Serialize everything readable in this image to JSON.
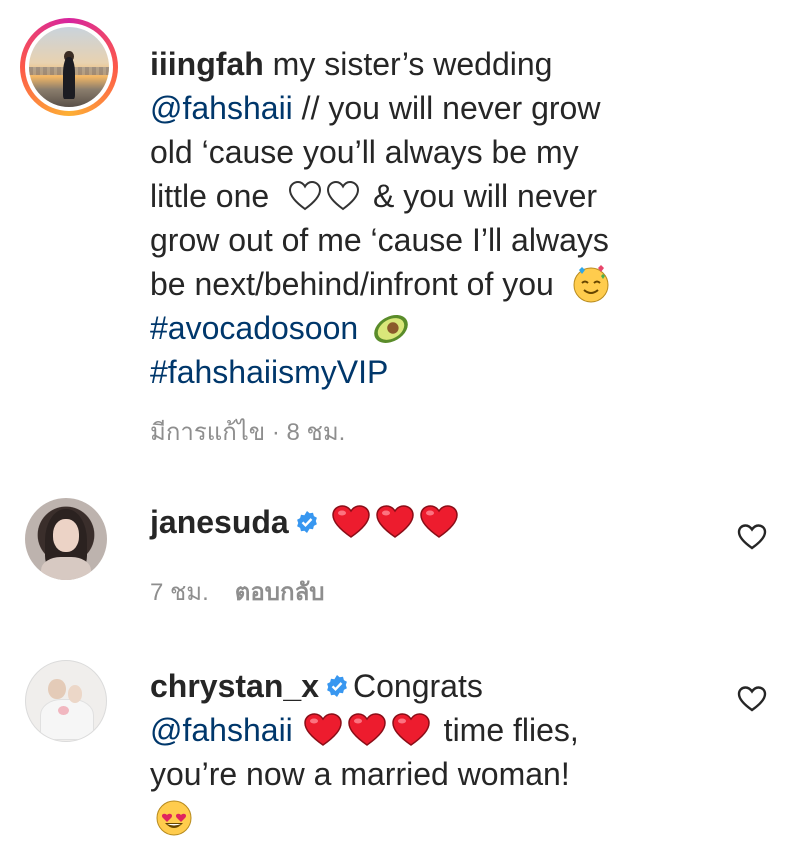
{
  "comments": [
    {
      "username": "iiingfah",
      "line1_text": " my sister’s wedding",
      "mention": "@fahshaii",
      "line2_text": " // you will never grow",
      "line3_text": "old ‘cause you’ll always be my",
      "line4_text": "little one",
      "line4_after": " & you will never",
      "line5_text": "grow out of me ‘cause I’ll always",
      "line6_text": "be next/behind/infront of you",
      "hashtag1": "#avocadosoon",
      "hashtag2": "#fahshaiismyVIP",
      "meta": "มีการแก้ไข · 8 ชม.",
      "emojis": [
        "white-heart",
        "white-heart",
        "smiling-face-with-hearts",
        "avocado"
      ]
    },
    {
      "username": "janesuda",
      "verified": true,
      "time": "7 ชม.",
      "reply_label": "ตอบกลับ",
      "emojis": [
        "red-heart",
        "red-heart",
        "red-heart"
      ]
    },
    {
      "username": "chrystan_x",
      "verified": true,
      "line1_text": "Congrats",
      "mention": "@fahshaii",
      "line2_after": " time flies,",
      "line3_text": "you’re now a married woman!",
      "emojis": [
        "red-heart",
        "red-heart",
        "red-heart",
        "heart-eyes-face"
      ]
    }
  ],
  "icons": [
    "heart-outline-icon",
    "verified-badge-icon"
  ],
  "colors": {
    "text": "#262626",
    "link": "#00376b",
    "meta": "#8e8e8e",
    "verified": "#3897f0",
    "heart": "#ed1c2e"
  }
}
